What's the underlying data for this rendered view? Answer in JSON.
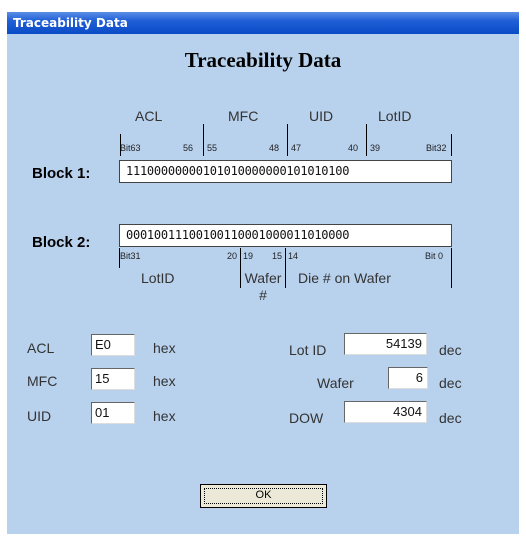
{
  "window": {
    "title": "Traceability Data"
  },
  "heading": "Traceability Data",
  "block1": {
    "label": "Block 1:",
    "bits": "11100000000101010000000101010100",
    "fields": [
      "ACL",
      "MFC",
      "UID",
      "LotID"
    ],
    "bit_labels": [
      "Bit63",
      "56",
      "55",
      "48",
      "47",
      "40",
      "39",
      "Bit32"
    ]
  },
  "block2": {
    "label": "Block 2:",
    "bits": "00010011100100110001000011010000",
    "fields": [
      "LotID",
      "Wafer #",
      "Die # on Wafer"
    ],
    "bit_labels": [
      "Bit31",
      "20",
      "19",
      "15",
      "14",
      "Bit 0"
    ]
  },
  "values": {
    "acl": {
      "label": "ACL",
      "value": "E0",
      "unit": "hex"
    },
    "mfc": {
      "label": "MFC",
      "value": "15",
      "unit": "hex"
    },
    "uid": {
      "label": "UID",
      "value": "01",
      "unit": "hex"
    },
    "lot_id": {
      "label": "Lot ID",
      "value": "54139",
      "unit": "dec"
    },
    "wafer": {
      "label": "Wafer",
      "value": "6",
      "unit": "dec"
    },
    "dow": {
      "label": "DOW",
      "value": "4304",
      "unit": "dec"
    }
  },
  "ok_label": "OK"
}
